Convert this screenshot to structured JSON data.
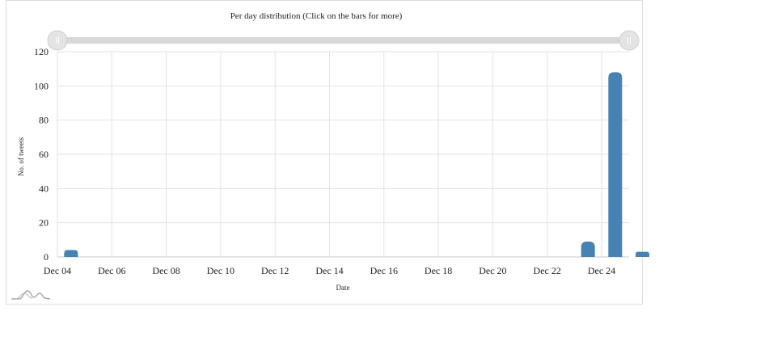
{
  "chart_data": {
    "type": "bar",
    "title": "Per day distribution (Click on the bars for more)",
    "xlabel": "Date",
    "ylabel": "No. of tweets",
    "ylim": [
      0,
      120
    ],
    "yticks": [
      0,
      20,
      40,
      60,
      80,
      100,
      120
    ],
    "x_tick_labels": [
      "Dec 04",
      "Dec 06",
      "Dec 08",
      "Dec 10",
      "Dec 12",
      "Dec 14",
      "Dec 16",
      "Dec 18",
      "Dec 20",
      "Dec 22",
      "Dec 24"
    ],
    "categories": [
      "Dec 04",
      "Dec 05",
      "Dec 06",
      "Dec 07",
      "Dec 08",
      "Dec 09",
      "Dec 10",
      "Dec 11",
      "Dec 12",
      "Dec 13",
      "Dec 14",
      "Dec 15",
      "Dec 16",
      "Dec 17",
      "Dec 18",
      "Dec 19",
      "Dec 20",
      "Dec 21",
      "Dec 22",
      "Dec 23",
      "Dec 24",
      "Dec 25"
    ],
    "values": [
      4,
      0,
      0,
      0,
      0,
      0,
      0,
      0,
      0,
      0,
      0,
      0,
      0,
      0,
      0,
      0,
      0,
      0,
      0,
      9,
      108,
      3
    ],
    "bar_color": "#4682b4",
    "grid": true,
    "range_selector": true
  }
}
